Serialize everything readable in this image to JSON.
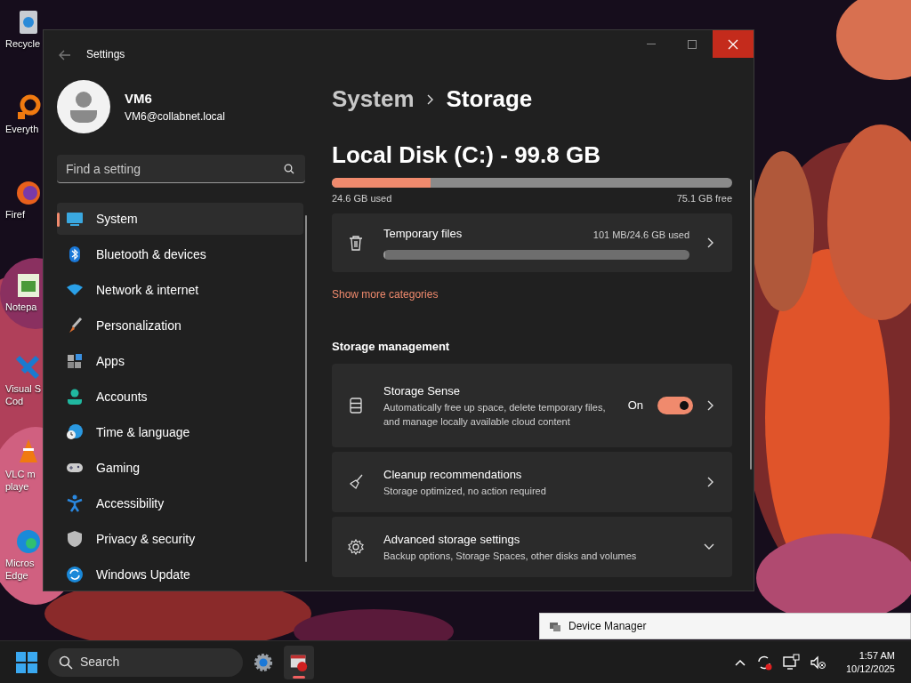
{
  "desktop_icons": [
    {
      "kind": "recycle",
      "lines": [
        "Recycle"
      ]
    },
    {
      "kind": "search-app",
      "lines": [
        "Everyth"
      ]
    },
    {
      "kind": "browser",
      "lines": [
        "Firef"
      ]
    },
    {
      "kind": "notepad",
      "lines": [
        "Notepa"
      ]
    },
    {
      "kind": "code",
      "lines": [
        "Visual S",
        "Cod"
      ]
    },
    {
      "kind": "cone",
      "lines": [
        "VLC m",
        "playe"
      ]
    },
    {
      "kind": "edge",
      "lines": [
        "Micros",
        "Edge"
      ]
    }
  ],
  "window": {
    "title": "Settings",
    "user": {
      "name": "VM6",
      "email": "VM6@collabnet.local"
    },
    "search": {
      "placeholder": "Find a setting"
    },
    "nav_items": [
      {
        "kind": "system",
        "label": "System",
        "selected": true
      },
      {
        "kind": "bluetooth",
        "label": "Bluetooth & devices",
        "selected": false
      },
      {
        "kind": "network",
        "label": "Network & internet",
        "selected": false
      },
      {
        "kind": "brush",
        "label": "Personalization",
        "selected": false
      },
      {
        "kind": "apps",
        "label": "Apps",
        "selected": false
      },
      {
        "kind": "accounts",
        "label": "Accounts",
        "selected": false
      },
      {
        "kind": "time",
        "label": "Time & language",
        "selected": false
      },
      {
        "kind": "gaming",
        "label": "Gaming",
        "selected": false
      },
      {
        "kind": "accessibility",
        "label": "Accessibility",
        "selected": false
      },
      {
        "kind": "privacy",
        "label": "Privacy & security",
        "selected": false
      },
      {
        "kind": "update",
        "label": "Windows Update",
        "selected": false
      }
    ],
    "breadcrumb": [
      "System",
      "Storage"
    ],
    "disk": {
      "title": "Local Disk (C:) - 99.8 GB",
      "level": 0.247,
      "used": "24.6 GB used",
      "free": "75.1 GB free"
    },
    "categories": [
      {
        "kind": "trash",
        "label": "Temporary files",
        "reading": "101 MB/24.6 GB used",
        "level": 0.004
      }
    ],
    "show_more_link": "Show more categories",
    "section_title": "Storage management",
    "settings": [
      {
        "kind": "storage-sense",
        "title": "Storage Sense",
        "description": "Automatically free up space, delete temporary files, and manage locally available cloud content",
        "toggle": {
          "on": true,
          "label": "On"
        },
        "expandable": false
      },
      {
        "kind": "cleanup",
        "title": "Cleanup recommendations",
        "description": "Storage optimized, no action required",
        "expandable": false
      },
      {
        "kind": "advanced",
        "title": "Advanced storage settings",
        "description": "Backup options, Storage Spaces, other disks and volumes",
        "expandable": true
      }
    ]
  },
  "tooltip": "Device Manager",
  "taskbar": {
    "search_label": "Search",
    "apps": [
      {
        "kind": "settings",
        "selected": false
      },
      {
        "kind": "device-manager",
        "selected": true
      }
    ],
    "time": "1:57 AM",
    "date": "10/12/2025"
  }
}
